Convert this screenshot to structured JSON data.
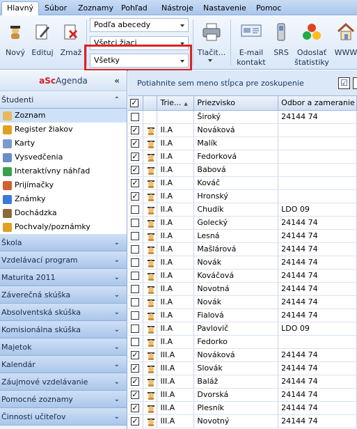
{
  "menu": [
    "Hlavný",
    "Súbor",
    "Zoznamy",
    "Pohľad",
    "Nástroje",
    "Nastavenie",
    "Pomoc"
  ],
  "ribbon": {
    "new_label": "Nový",
    "edit_label": "Edituj",
    "delete_label": "Zmaž",
    "sort_value": "Podľa abecedy",
    "students_value": "Všetci žiaci",
    "filter_value": "Všetky",
    "print_label": "Tlačit...",
    "email_label": "E-mail\nkontakt",
    "sms_label": "SRS",
    "stats_label": "Odoslať\nštatistiky",
    "www_label": "WWW"
  },
  "sidebar": {
    "app_name_a": "aSc",
    "app_name_b": "Agenda",
    "collapse": "«",
    "students_section": "Študenti",
    "items": [
      {
        "label": "Zoznam",
        "icon": "student-icon"
      },
      {
        "label": "Register žiakov",
        "icon": "lock-icon"
      },
      {
        "label": "Karty",
        "icon": "cards-icon"
      },
      {
        "label": "Vysvedčenia",
        "icon": "certificate-icon"
      },
      {
        "label": "Interaktívny náhľad",
        "icon": "preview-icon"
      },
      {
        "label": "Prijímačky",
        "icon": "people-icon"
      },
      {
        "label": "Známky",
        "icon": "grades-icon"
      },
      {
        "label": "Dochádzka",
        "icon": "attendance-icon"
      },
      {
        "label": "Pochvaly/poznámky",
        "icon": "praise-icon"
      }
    ],
    "sections": [
      "Škola",
      "Vzdelávací program",
      "Maturita 2011",
      "Záverečná skúška",
      "Absolventská skúška",
      "Komisionálna skúška",
      "Majetok",
      "Kalendár",
      "Záujmové vzdelávanie",
      "Pomocné zoznamy",
      "Činnosti učiteľov"
    ]
  },
  "grid": {
    "group_hint": "Potiahnite sem meno stĺpca pre zoskupenie",
    "columns": [
      "Trie...",
      "Priezvisko",
      "Odbor a zameranie"
    ],
    "rows": [
      {
        "checked": false,
        "face": false,
        "cls": "",
        "name": "Široký",
        "field": "24144 74"
      },
      {
        "checked": true,
        "face": true,
        "cls": "II.A",
        "name": "Nováková",
        "field": ""
      },
      {
        "checked": true,
        "face": true,
        "cls": "II.A",
        "name": "Malík",
        "field": ""
      },
      {
        "checked": true,
        "face": true,
        "cls": "II.A",
        "name": "Fedorková",
        "field": ""
      },
      {
        "checked": true,
        "face": true,
        "cls": "II.A",
        "name": "Babová",
        "field": ""
      },
      {
        "checked": true,
        "face": true,
        "cls": "II.A",
        "name": "Kováč",
        "field": ""
      },
      {
        "checked": true,
        "face": true,
        "cls": "II.A",
        "name": "Hronský",
        "field": ""
      },
      {
        "checked": false,
        "face": true,
        "cls": "II.A",
        "name": "Chudík",
        "field": "LDO 09"
      },
      {
        "checked": false,
        "face": true,
        "cls": "II.A",
        "name": "Golecký",
        "field": "24144 74"
      },
      {
        "checked": false,
        "face": true,
        "cls": "II.A",
        "name": "Lesná",
        "field": "24144 74"
      },
      {
        "checked": false,
        "face": true,
        "cls": "II.A",
        "name": "Mašlárová",
        "field": "24144 74"
      },
      {
        "checked": false,
        "face": true,
        "cls": "II.A",
        "name": "Novák",
        "field": "24144 74"
      },
      {
        "checked": false,
        "face": true,
        "cls": "II.A",
        "name": "Kováčová",
        "field": "24144 74"
      },
      {
        "checked": false,
        "face": true,
        "cls": "II.A",
        "name": "Novotná",
        "field": "24144 74"
      },
      {
        "checked": false,
        "face": true,
        "cls": "II.A",
        "name": "Novák",
        "field": "24144 74"
      },
      {
        "checked": false,
        "face": true,
        "cls": "II.A",
        "name": "Fialová",
        "field": "24144 74"
      },
      {
        "checked": false,
        "face": true,
        "cls": "II.A",
        "name": "Pavlovič",
        "field": "LDO 09"
      },
      {
        "checked": false,
        "face": true,
        "cls": "II.A",
        "name": "Fedorko",
        "field": ""
      },
      {
        "checked": true,
        "face": true,
        "cls": "III.A",
        "name": "Nováková",
        "field": "24144 74"
      },
      {
        "checked": true,
        "face": true,
        "cls": "III.A",
        "name": "Slovák",
        "field": "24144 74"
      },
      {
        "checked": true,
        "face": true,
        "cls": "III.A",
        "name": "Baláž",
        "field": "24144 74"
      },
      {
        "checked": true,
        "face": true,
        "cls": "III.A",
        "name": "Dvorská",
        "field": "24144 74"
      },
      {
        "checked": true,
        "face": true,
        "cls": "III.A",
        "name": "Plesník",
        "field": "24144 74"
      },
      {
        "checked": true,
        "face": true,
        "cls": "III.A",
        "name": "Novotný",
        "field": "24144 74"
      }
    ]
  }
}
